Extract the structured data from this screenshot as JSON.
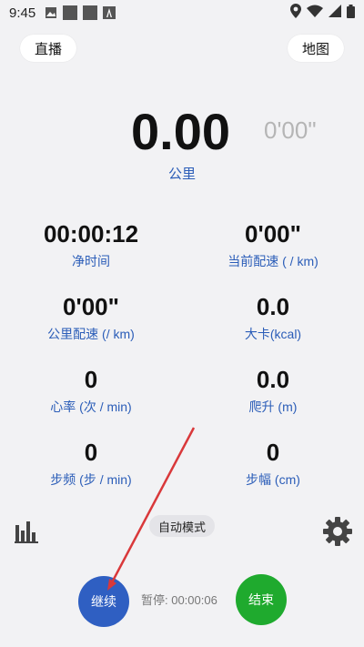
{
  "status_bar": {
    "time": "9:45",
    "left_icons": [
      "image-icon",
      "square-icon",
      "square-icon",
      "text-a-icon"
    ],
    "right_icons": [
      "location-icon",
      "wifi-icon",
      "signal-icon",
      "battery-icon"
    ]
  },
  "header": {
    "left_button": "直播",
    "right_button": "地图"
  },
  "main": {
    "distance_value": "0.00",
    "pace_value": "0'00\"",
    "distance_unit": "公里"
  },
  "stats": [
    {
      "value": "00:00:12",
      "label": "净时间"
    },
    {
      "value": "0'00\"",
      "label": "当前配速 ( / km)"
    },
    {
      "value": "0'00\"",
      "label": "公里配速 (/ km)"
    },
    {
      "value": "0.0",
      "label": "大卡(kcal)"
    },
    {
      "value": "0",
      "label": "心率 (次 / min)"
    },
    {
      "value": "0.0",
      "label": "爬升 (m)"
    },
    {
      "value": "0",
      "label": "步频 (步 / min)"
    },
    {
      "value": "0",
      "label": "步幅 (cm)"
    }
  ],
  "controls": {
    "auto_mode": "自动模式",
    "continue_label": "继续",
    "pause_label": "暂停: 00:00:06",
    "end_label": "结束"
  },
  "colors": {
    "accent_blue": "#2b5db8",
    "continue_button": "#2f5fc2",
    "end_button": "#1faa2e",
    "annotation_arrow": "#d9383a"
  }
}
